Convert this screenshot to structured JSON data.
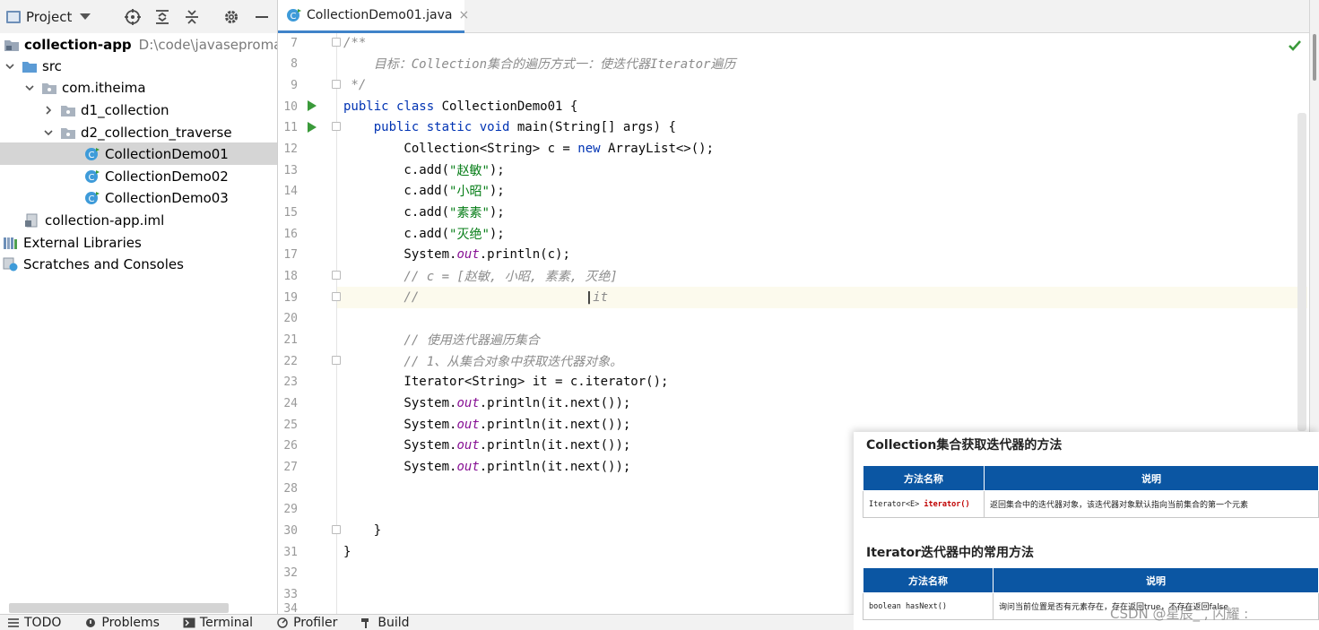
{
  "project_panel": {
    "title": "Project",
    "tree": [
      {
        "label": "collection-app",
        "path": "D:\\code\\javasepromax\\colle",
        "icon": "module-folder-icon"
      },
      {
        "label": "src",
        "icon": "source-folder-icon"
      },
      {
        "label": "com.itheima",
        "icon": "package-icon"
      },
      {
        "label": "d1_collection",
        "icon": "package-icon"
      },
      {
        "label": "d2_collection_traverse",
        "icon": "package-icon"
      },
      {
        "label": "CollectionDemo01",
        "icon": "java-class-icon",
        "selected": true
      },
      {
        "label": "CollectionDemo02",
        "icon": "java-class-icon"
      },
      {
        "label": "CollectionDemo03",
        "icon": "java-class-icon"
      },
      {
        "label": "collection-app.iml",
        "icon": "iml-file-icon"
      },
      {
        "label": "External Libraries",
        "icon": "libraries-icon"
      },
      {
        "label": "Scratches and Consoles",
        "icon": "scratches-icon"
      }
    ]
  },
  "editor": {
    "tab": {
      "label": "CollectionDemo01.java",
      "close": "×"
    },
    "lines": [
      {
        "n": "7",
        "t": "/**"
      },
      {
        "n": "8",
        "t": "    目标：Collection集合的遍历方式一：使迭代器Iterator遍历"
      },
      {
        "n": "9",
        "t": " */"
      },
      {
        "n": "10",
        "a": "public class",
        "b": " CollectionDemo01 {"
      },
      {
        "n": "11",
        "a": "    public static void",
        "b": " main(String[] args) {"
      },
      {
        "n": "12",
        "a": "        Collection<String> c = ",
        "b": "new",
        "c": " ArrayList<>();"
      },
      {
        "n": "13",
        "a": "        c.add(",
        "b": "\"赵敏\"",
        "c": ");"
      },
      {
        "n": "14",
        "a": "        c.add(",
        "b": "\"小昭\"",
        "c": ");"
      },
      {
        "n": "15",
        "a": "        c.add(",
        "b": "\"素素\"",
        "c": ");"
      },
      {
        "n": "16",
        "a": "        c.add(",
        "b": "\"灭绝\"",
        "c": ");"
      },
      {
        "n": "17",
        "a": "        System.",
        "b": "out",
        "c": ".println(c);"
      },
      {
        "n": "18",
        "t": "        // c = [赵敏, 小昭, 素素, 灭绝]"
      },
      {
        "n": "19",
        "a": "        //                      ",
        "b": "it"
      },
      {
        "n": "20",
        "t": ""
      },
      {
        "n": "21",
        "t": "        // 使用迭代器遍历集合"
      },
      {
        "n": "22",
        "t": "        // 1、从集合对象中获取迭代器对象。"
      },
      {
        "n": "23",
        "t": "        Iterator<String> it = c.iterator();"
      },
      {
        "n": "24",
        "a": "        System.",
        "b": "out",
        "c": ".println(it.next());"
      },
      {
        "n": "25",
        "a": "        System.",
        "b": "out",
        "c": ".println(it.next());"
      },
      {
        "n": "26",
        "a": "        System.",
        "b": "out",
        "c": ".println(it.next());"
      },
      {
        "n": "27",
        "a": "        System.",
        "b": "out",
        "c": ".println(it.next());"
      },
      {
        "n": "28",
        "t": ""
      },
      {
        "n": "29",
        "t": ""
      },
      {
        "n": "30",
        "t": "    }"
      },
      {
        "n": "31",
        "t": "}"
      },
      {
        "n": "32",
        "t": ""
      },
      {
        "n": "33",
        "t": ""
      },
      {
        "n": "34",
        "t": ""
      }
    ]
  },
  "slide": {
    "title1": "Collection集合获取迭代器的方法",
    "table1": {
      "headers": [
        "方法名称",
        "说明"
      ],
      "row": {
        "sig_type": "Iterator<E> ",
        "sig_method": "iterator()",
        "desc": "返回集合中的迭代器对象，该迭代器对象默认指向当前集合的第一个元素"
      }
    },
    "title2": "Iterator迭代器中的常用方法",
    "table2": {
      "headers": [
        "方法名称",
        "说明"
      ],
      "row": {
        "sig": "boolean hasNext()",
        "desc": "询问当前位置是否有元素存在，存在返回true，不存在返回false"
      }
    }
  },
  "watermark": "CSDN @星辰_ , 闪耀 :",
  "bottom_bar": [
    {
      "label": "TODO",
      "icon": "list-icon"
    },
    {
      "label": "Problems",
      "icon": "problems-icon"
    },
    {
      "label": "Terminal",
      "icon": "terminal-icon"
    },
    {
      "label": "Profiler",
      "icon": "profiler-icon"
    },
    {
      "label": "Build",
      "icon": "hammer-icon"
    }
  ],
  "colors": {
    "keyword": "#0033b3",
    "string": "#067d17",
    "comment": "#8c8c8c",
    "static_field": "#871094",
    "selection": "#d5d5d5",
    "tab_underline": "#4083c9",
    "slide_header": "#0b56a3"
  }
}
